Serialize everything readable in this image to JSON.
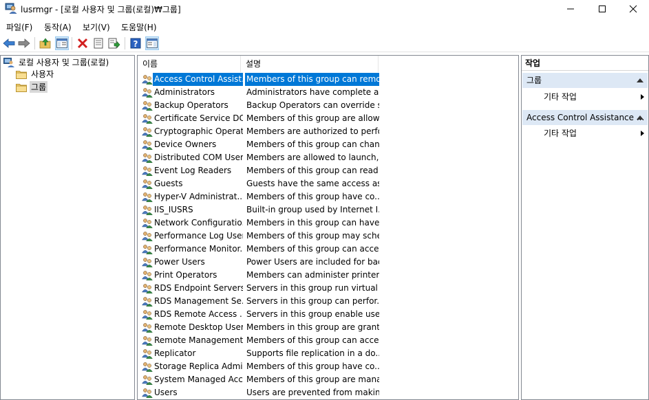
{
  "window": {
    "title": "lusrmgr - [로컬 사용자 및 그룹(로컬)₩그룹]"
  },
  "menu": [
    "파일(F)",
    "동작(A)",
    "보기(V)",
    "도움말(H)"
  ],
  "toolbar": {
    "buttons": [
      "back-icon",
      "forward-icon",
      "up-folder-icon",
      "show-hide-tree-icon",
      "delete-icon",
      "properties-icon",
      "export-icon",
      "help-icon",
      "show-hide-action-pane-icon"
    ]
  },
  "tree": {
    "root": "로컬 사용자 및 그룹(로컬)",
    "children": [
      "사용자",
      "그룹"
    ],
    "selected": "그룹"
  },
  "list": {
    "columns": [
      "이름",
      "설명"
    ],
    "rows": [
      {
        "name": "Access Control Assist...",
        "desc": "Members of this group can remo..."
      },
      {
        "name": "Administrators",
        "desc": "Administrators have complete an..."
      },
      {
        "name": "Backup Operators",
        "desc": "Backup Operators can override s..."
      },
      {
        "name": "Certificate Service DC...",
        "desc": "Members of this group are allow..."
      },
      {
        "name": "Cryptographic Operat...",
        "desc": "Members are authorized to perfo..."
      },
      {
        "name": "Device Owners",
        "desc": "Members of this group can chan..."
      },
      {
        "name": "Distributed COM Users",
        "desc": "Members are allowed to launch, ..."
      },
      {
        "name": "Event Log Readers",
        "desc": "Members of this group can read ..."
      },
      {
        "name": "Guests",
        "desc": "Guests have the same access as ..."
      },
      {
        "name": "Hyper-V Administrat...",
        "desc": "Members of this group have co..."
      },
      {
        "name": "IIS_IUSRS",
        "desc": "Built-in group used by Internet I..."
      },
      {
        "name": "Network Configuratio...",
        "desc": "Members in this group can have ..."
      },
      {
        "name": "Performance Log Users",
        "desc": "Members of this group may sche..."
      },
      {
        "name": "Performance Monitor...",
        "desc": "Members of this group can acce..."
      },
      {
        "name": "Power Users",
        "desc": "Power Users are included for bac..."
      },
      {
        "name": "Print Operators",
        "desc": "Members can administer printers..."
      },
      {
        "name": "RDS Endpoint Servers",
        "desc": "Servers in this group run virtual ..."
      },
      {
        "name": "RDS Management Se...",
        "desc": "Servers in this group can perfor..."
      },
      {
        "name": "RDS Remote Access ...",
        "desc": "Servers in this group enable user..."
      },
      {
        "name": "Remote Desktop Users",
        "desc": "Members in this group are grant..."
      },
      {
        "name": "Remote Management...",
        "desc": "Members of this group can acce..."
      },
      {
        "name": "Replicator",
        "desc": "Supports file replication in a do..."
      },
      {
        "name": "Storage Replica Admi...",
        "desc": "Members of this group have co..."
      },
      {
        "name": "System Managed Acc...",
        "desc": "Members of this group are mana..."
      },
      {
        "name": "Users",
        "desc": "Users are prevented from making..."
      }
    ],
    "selected_index": 0
  },
  "actions": {
    "title": "작업",
    "sections": [
      {
        "label": "그룹",
        "item": "기타 작업"
      },
      {
        "label": "Access Control Assistance ...",
        "item": "기타 작업"
      }
    ]
  },
  "colors": {
    "selection": "#0078d7",
    "section_bg": "#dde8f5",
    "border": "#828790"
  }
}
